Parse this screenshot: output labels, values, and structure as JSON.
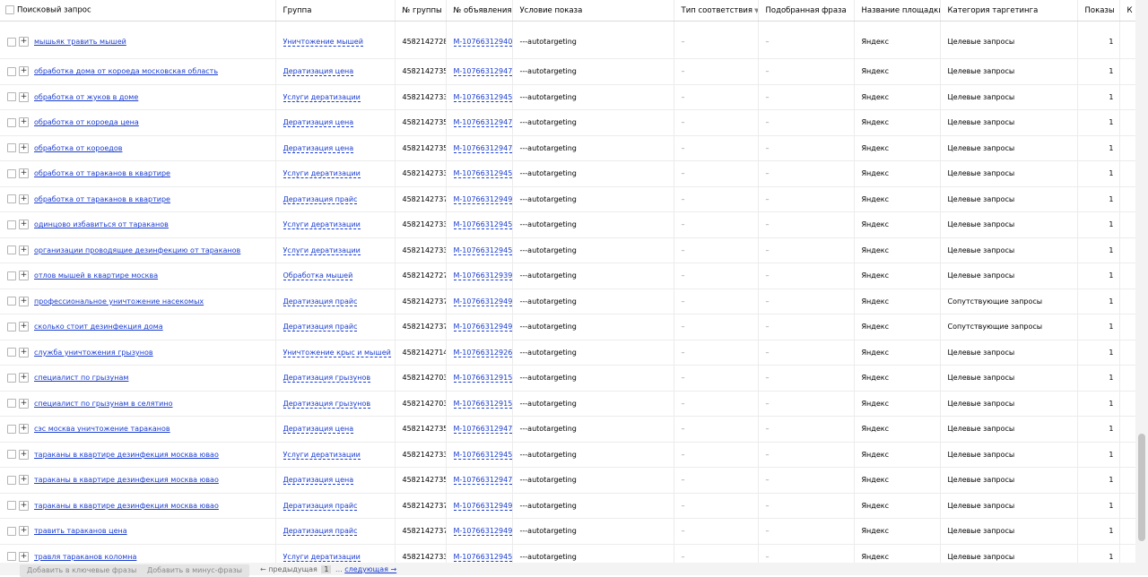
{
  "columns": {
    "query": "Поисковый запрос",
    "group": "Группа",
    "group_no": "№ группы",
    "ad_no": "№ объявления",
    "condition": "Условие показа",
    "match_type": "Тип соответствия",
    "phrase": "Подобранная фраза",
    "platform": "Название площадки",
    "category": "Категория таргетинга",
    "impressions": "Показы",
    "extra": "К"
  },
  "sort_icon": "filter-triangle-down-icon",
  "rows": [
    {
      "query": "мышьяк травить мышей",
      "group": "Уничтожение мышей",
      "group_no": "4582142728",
      "ad_no": "M-10766312940",
      "condition": "---autotargeting",
      "match_type": "–",
      "phrase": "–",
      "platform": "Яндекс",
      "category": "Целевые запросы",
      "impressions": "1"
    },
    {
      "query": "обработка дома от короеда московская область",
      "group": "Дератизация цена",
      "group_no": "4582142735",
      "ad_no": "M-10766312947",
      "condition": "---autotargeting",
      "match_type": "–",
      "phrase": "–",
      "platform": "Яндекс",
      "category": "Целевые запросы",
      "impressions": "1"
    },
    {
      "query": "обработка от жуков в доме",
      "group": "Услуги дератизации",
      "group_no": "4582142733",
      "ad_no": "M-10766312945",
      "condition": "---autotargeting",
      "match_type": "–",
      "phrase": "–",
      "platform": "Яндекс",
      "category": "Целевые запросы",
      "impressions": "1"
    },
    {
      "query": "обработка от короеда цена",
      "group": "Дератизация цена",
      "group_no": "4582142735",
      "ad_no": "M-10766312947",
      "condition": "---autotargeting",
      "match_type": "–",
      "phrase": "–",
      "platform": "Яндекс",
      "category": "Целевые запросы",
      "impressions": "1"
    },
    {
      "query": "обработка от короедов",
      "group": "Дератизация цена",
      "group_no": "4582142735",
      "ad_no": "M-10766312947",
      "condition": "---autotargeting",
      "match_type": "–",
      "phrase": "–",
      "platform": "Яндекс",
      "category": "Целевые запросы",
      "impressions": "1"
    },
    {
      "query": "обработка от тараканов в квартире",
      "group": "Услуги дератизации",
      "group_no": "4582142733",
      "ad_no": "M-10766312945",
      "condition": "---autotargeting",
      "match_type": "–",
      "phrase": "–",
      "platform": "Яндекс",
      "category": "Целевые запросы",
      "impressions": "1"
    },
    {
      "query": "обработка от тараканов в квартире",
      "group": "Дератизация прайс",
      "group_no": "4582142737",
      "ad_no": "M-10766312949",
      "condition": "---autotargeting",
      "match_type": "–",
      "phrase": "–",
      "platform": "Яндекс",
      "category": "Целевые запросы",
      "impressions": "1"
    },
    {
      "query": "одинцово избавиться от тараканов",
      "group": "Услуги дератизации",
      "group_no": "4582142733",
      "ad_no": "M-10766312945",
      "condition": "---autotargeting",
      "match_type": "–",
      "phrase": "–",
      "platform": "Яндекс",
      "category": "Целевые запросы",
      "impressions": "1"
    },
    {
      "query": "организации проводящие дезинфекцию от тараканов",
      "group": "Услуги дератизации",
      "group_no": "4582142733",
      "ad_no": "M-10766312945",
      "condition": "---autotargeting",
      "match_type": "–",
      "phrase": "–",
      "platform": "Яндекс",
      "category": "Целевые запросы",
      "impressions": "1"
    },
    {
      "query": "отлов мышей в квартире москва",
      "group": "Обработка мышей",
      "group_no": "4582142727",
      "ad_no": "M-10766312939",
      "condition": "---autotargeting",
      "match_type": "–",
      "phrase": "–",
      "platform": "Яндекс",
      "category": "Целевые запросы",
      "impressions": "1"
    },
    {
      "query": "профессиональное уничтожение насекомых",
      "group": "Дератизация прайс",
      "group_no": "4582142737",
      "ad_no": "M-10766312949",
      "condition": "---autotargeting",
      "match_type": "–",
      "phrase": "–",
      "platform": "Яндекс",
      "category": "Сопутствующие запросы",
      "impressions": "1"
    },
    {
      "query": "сколько стоит дезинфекция дома",
      "group": "Дератизация прайс",
      "group_no": "4582142737",
      "ad_no": "M-10766312949",
      "condition": "---autotargeting",
      "match_type": "–",
      "phrase": "–",
      "platform": "Яндекс",
      "category": "Сопутствующие запросы",
      "impressions": "1"
    },
    {
      "query": "служба уничтожения грызунов",
      "group": "Уничтожение крыс и мышей",
      "group_no": "4582142714",
      "ad_no": "M-10766312926",
      "condition": "---autotargeting",
      "match_type": "–",
      "phrase": "–",
      "platform": "Яндекс",
      "category": "Целевые запросы",
      "impressions": "1"
    },
    {
      "query": "специалист по грызунам",
      "group": "Дератизация грызунов",
      "group_no": "4582142703",
      "ad_no": "M-10766312915",
      "condition": "---autotargeting",
      "match_type": "–",
      "phrase": "–",
      "platform": "Яндекс",
      "category": "Целевые запросы",
      "impressions": "1"
    },
    {
      "query": "специалист по грызунам в селятино",
      "group": "Дератизация грызунов",
      "group_no": "4582142703",
      "ad_no": "M-10766312915",
      "condition": "---autotargeting",
      "match_type": "–",
      "phrase": "–",
      "platform": "Яндекс",
      "category": "Целевые запросы",
      "impressions": "1"
    },
    {
      "query": "сэс москва уничтожение тараканов",
      "group": "Дератизация цена",
      "group_no": "4582142735",
      "ad_no": "M-10766312947",
      "condition": "---autotargeting",
      "match_type": "–",
      "phrase": "–",
      "platform": "Яндекс",
      "category": "Целевые запросы",
      "impressions": "1"
    },
    {
      "query": "тараканы в квартире дезинфекция москва ювао",
      "group": "Услуги дератизации",
      "group_no": "4582142733",
      "ad_no": "M-10766312945",
      "condition": "---autotargeting",
      "match_type": "–",
      "phrase": "–",
      "platform": "Яндекс",
      "category": "Целевые запросы",
      "impressions": "1"
    },
    {
      "query": "тараканы в квартире дезинфекция москва ювао",
      "group": "Дератизация цена",
      "group_no": "4582142735",
      "ad_no": "M-10766312947",
      "condition": "---autotargeting",
      "match_type": "–",
      "phrase": "–",
      "platform": "Яндекс",
      "category": "Целевые запросы",
      "impressions": "1"
    },
    {
      "query": "тараканы в квартире дезинфекция москва ювао",
      "group": "Дератизация прайс",
      "group_no": "4582142737",
      "ad_no": "M-10766312949",
      "condition": "---autotargeting",
      "match_type": "–",
      "phrase": "–",
      "platform": "Яндекс",
      "category": "Целевые запросы",
      "impressions": "1"
    },
    {
      "query": "травить тараканов цена",
      "group": "Дератизация прайс",
      "group_no": "4582142737",
      "ad_no": "M-10766312949",
      "condition": "---autotargeting",
      "match_type": "–",
      "phrase": "–",
      "platform": "Яндекс",
      "category": "Целевые запросы",
      "impressions": "1"
    },
    {
      "query": "травля тараканов коломна",
      "group": "Услуги дератизации",
      "group_no": "4582142733",
      "ad_no": "M-10766312945",
      "condition": "---autotargeting",
      "match_type": "–",
      "phrase": "–",
      "platform": "Яндекс",
      "category": "Целевые запросы",
      "impressions": "1"
    }
  ],
  "footer": {
    "add_keywords": "Добавить в ключевые фразы",
    "add_minus": "Добавить в минус-фразы",
    "prev": "← предыдущая",
    "current_page": "1",
    "ellipsis": "...",
    "next": "следующая →"
  }
}
